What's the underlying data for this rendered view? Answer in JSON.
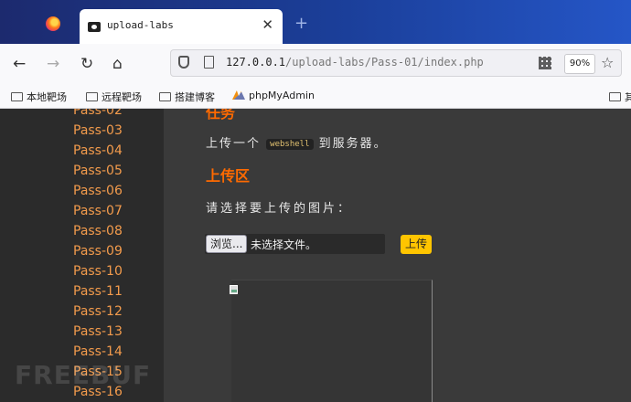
{
  "browser": {
    "tab_title": "upload-labs",
    "tab_close": "✕",
    "new_tab": "+",
    "url_host": "127.0.0.1",
    "url_path": "/upload-labs/Pass-01/index.php",
    "zoom": "90%",
    "nav": {
      "back": "←",
      "forward": "→",
      "reload": "↻",
      "home": "⌂"
    },
    "bookmarks": [
      "本地靶场",
      "远程靶场",
      "搭建博客",
      "phpMyAdmin",
      "其"
    ]
  },
  "sidebar": {
    "items": [
      "Pass-02",
      "Pass-03",
      "Pass-04",
      "Pass-05",
      "Pass-06",
      "Pass-07",
      "Pass-08",
      "Pass-09",
      "Pass-10",
      "Pass-11",
      "Pass-12",
      "Pass-13",
      "Pass-14",
      "Pass-15",
      "Pass-16"
    ]
  },
  "main": {
    "task_heading": "任务",
    "task_prefix": "上传一个",
    "task_code": "webshell",
    "task_suffix": "到服务器。",
    "upload_heading": "上传区",
    "select_prompt": "请选择要上传的图片：",
    "browse_label": "浏览...",
    "no_file_label": "未选择文件。",
    "submit_label": "上传"
  },
  "watermark": "FREEBUF",
  "colors": {
    "accent": "#ff6a00",
    "pass_link": "#f39b4c",
    "submit_bg": "#ffc500"
  }
}
